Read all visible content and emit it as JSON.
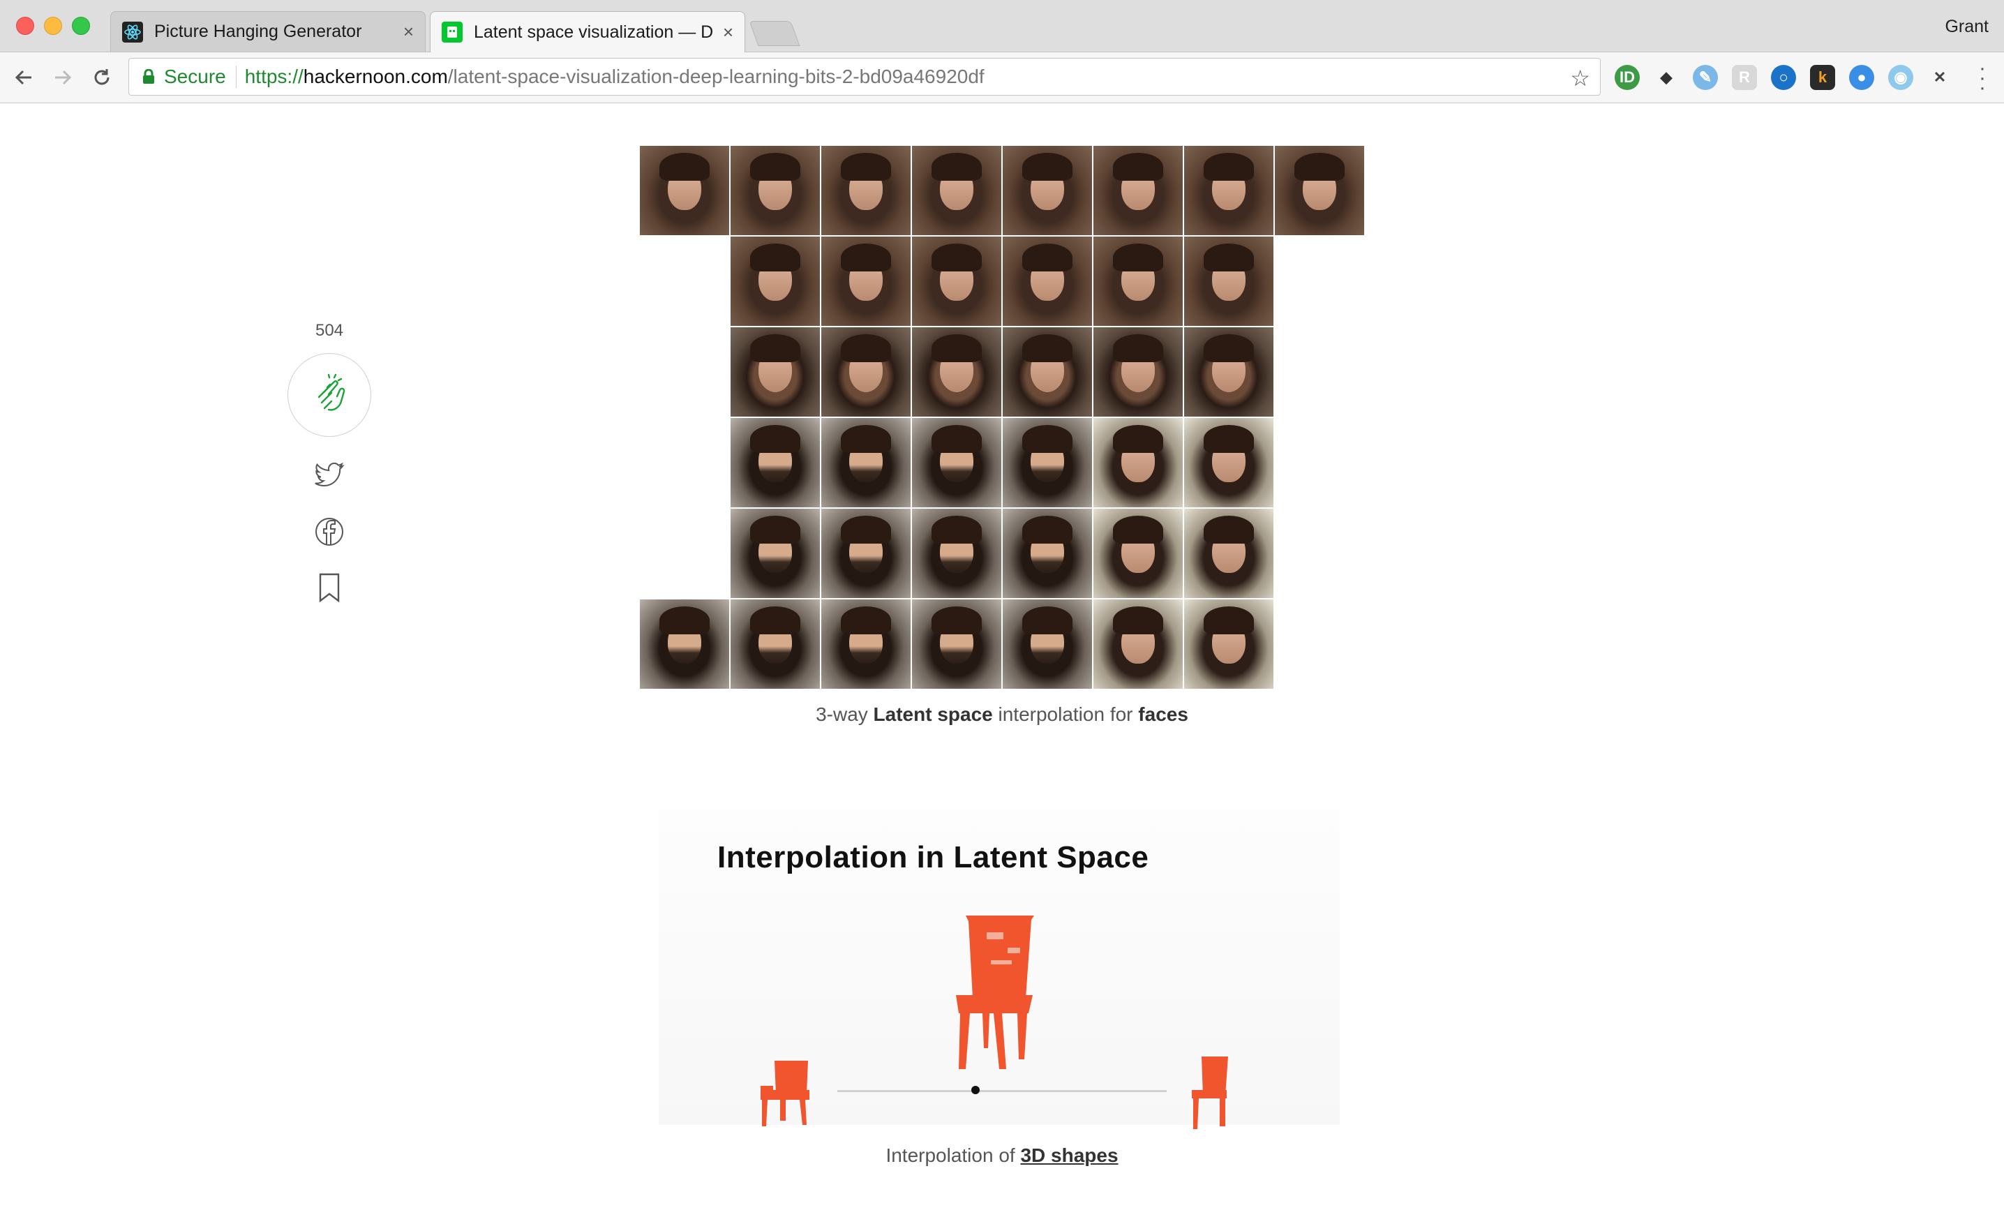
{
  "browser": {
    "tabs": [
      {
        "title": "Picture Hanging Generator",
        "close": "×"
      },
      {
        "title": "Latent space visualization — D",
        "close": "×"
      }
    ],
    "profile_name": "Grant",
    "address": {
      "secure_label": "Secure",
      "scheme": "https://",
      "host": "hackernoon.com",
      "path": "/latent-space-visualization-deep-learning-bits-2-bd09a46920df"
    },
    "extensions": [
      "ublock-icon",
      "ghostery-icon",
      "pen-icon",
      "readability-icon",
      "circle-icon",
      "k-icon",
      "record-icon",
      "target-icon",
      "pin-icon"
    ]
  },
  "share": {
    "clap_count": "504",
    "icons": [
      "clap-icon",
      "twitter-icon",
      "facebook-icon",
      "bookmark-icon"
    ]
  },
  "figure1": {
    "caption_pre": "3-way ",
    "caption_bold1": "Latent space",
    "caption_mid": " interpolation for ",
    "caption_bold2": "faces"
  },
  "figure2": {
    "title": "Interpolation in Latent Space",
    "caption_pre": "Interpolation of ",
    "caption_link": "3D shapes",
    "shape_color": "#f0552e"
  }
}
